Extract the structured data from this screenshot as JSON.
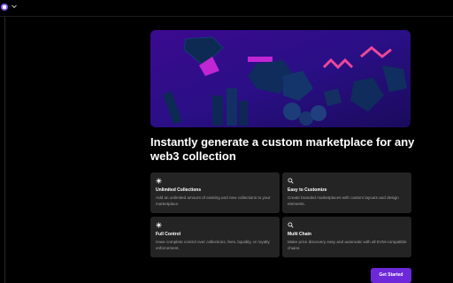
{
  "colors": {
    "accent": "#6d28d9",
    "background": "#000000",
    "card": "#242424",
    "muted_text": "#a3a3a3"
  },
  "header": {
    "logo_icon": "app-logo-icon",
    "menu_icon": "chevron-down-icon"
  },
  "hero": {
    "image_description": "purple 3D illustration of gems and shapes"
  },
  "headline": "Instantly generate a custom marketplace for any web3 collection",
  "features": [
    {
      "icon": "sparkle-icon",
      "title": "Unlimited Collections",
      "description": "Add an unlimited amount of existing and new collections to your marketplace."
    },
    {
      "icon": "search-icon",
      "title": "Easy to Customize",
      "description": "Create branded marketplaces with custom layouts and design elements."
    },
    {
      "icon": "sparkle-icon",
      "title": "Full Control",
      "description": "Have complete control over collections, fees, liquidity, or royalty enforcement."
    },
    {
      "icon": "search-icon",
      "title": "Multi Chain",
      "description": "Make price discovery easy and automatic with all EVM-compatible chains."
    }
  ],
  "cta": {
    "label": "Get Started"
  }
}
